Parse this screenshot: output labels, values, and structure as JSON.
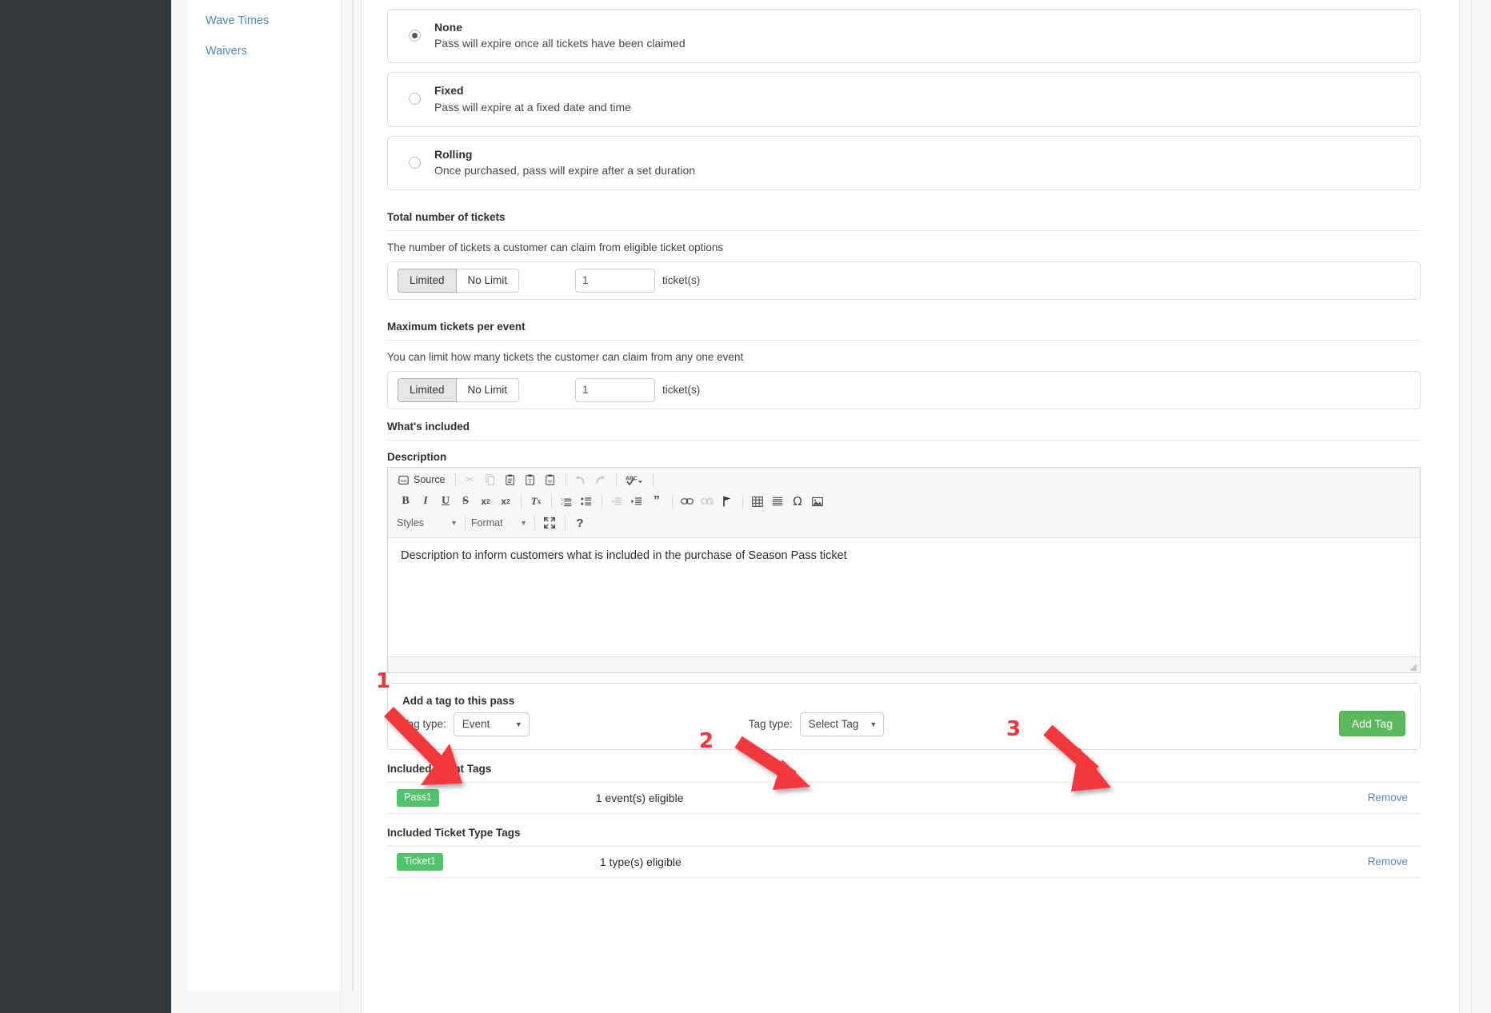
{
  "subnav": {
    "items": [
      {
        "label": "Wave Times"
      },
      {
        "label": "Waivers"
      }
    ]
  },
  "expiry": {
    "options": [
      {
        "title": "None",
        "desc": "Pass will expire once all tickets have been claimed",
        "selected": true
      },
      {
        "title": "Fixed",
        "desc": "Pass will expire at a fixed date and time",
        "selected": false
      },
      {
        "title": "Rolling",
        "desc": "Once purchased, pass will expire after a set duration",
        "selected": false
      }
    ]
  },
  "total_tickets": {
    "heading": "Total number of tickets",
    "description": "The number of tickets a customer can claim from eligible ticket options",
    "limited_label": "Limited",
    "nolimit_label": "No Limit",
    "active": "Limited",
    "value": "1",
    "unit": "ticket(s)"
  },
  "max_per_event": {
    "heading": "Maximum tickets per event",
    "description": "You can limit how many tickets the customer can claim from any one event",
    "limited_label": "Limited",
    "nolimit_label": "No Limit",
    "active": "Limited",
    "value": "1",
    "unit": "ticket(s)"
  },
  "whats_included": {
    "heading": "What's included",
    "description_label": "Description",
    "editor": {
      "source_label": "Source",
      "styles_label": "Styles",
      "format_label": "Format",
      "row1_icons": [
        "source-icon",
        "cut-icon",
        "copy-icon",
        "paste-icon",
        "paste-as-text-icon",
        "paste-from-word-icon",
        "undo-icon",
        "redo-icon",
        "spellcheck-icon"
      ],
      "row2_icons": [
        "bold-icon",
        "italic-icon",
        "underline-icon",
        "strikethrough-icon",
        "subscript-icon",
        "superscript-icon",
        "remove-format-icon",
        "numbered-list-icon",
        "bulleted-list-icon",
        "outdent-icon",
        "indent-icon",
        "blockquote-icon",
        "link-icon",
        "unlink-icon",
        "anchor-icon",
        "table-icon",
        "horizontal-rule-icon",
        "special-character-icon",
        "image-icon"
      ],
      "row3_icons": [
        "maximize-icon",
        "about-icon"
      ],
      "content": "Description to inform customers what is included in the purchase of Season Pass ticket"
    }
  },
  "add_tag": {
    "title": "Add a tag to this pass",
    "tag_type_label_left": "Tag type:",
    "tag_type_value_left": "Event",
    "tag_type_label_right": "Tag type:",
    "tag_type_value_right": "Select Tag",
    "add_button": "Add Tag",
    "button_color": "#5cb85c"
  },
  "included_event_tags": {
    "heading": "Included Event Tags",
    "rows": [
      {
        "chip": "Pass1",
        "count": "1 event(s) eligible",
        "remove": "Remove"
      }
    ]
  },
  "included_ticket_type_tags": {
    "heading": "Included Ticket Type Tags",
    "rows": [
      {
        "chip": "Ticket1",
        "count": "1 type(s) eligible",
        "remove": "Remove"
      }
    ]
  },
  "annotations": {
    "color": "#f0353b",
    "markers": [
      {
        "label": "1"
      },
      {
        "label": "2"
      },
      {
        "label": "3"
      }
    ]
  }
}
